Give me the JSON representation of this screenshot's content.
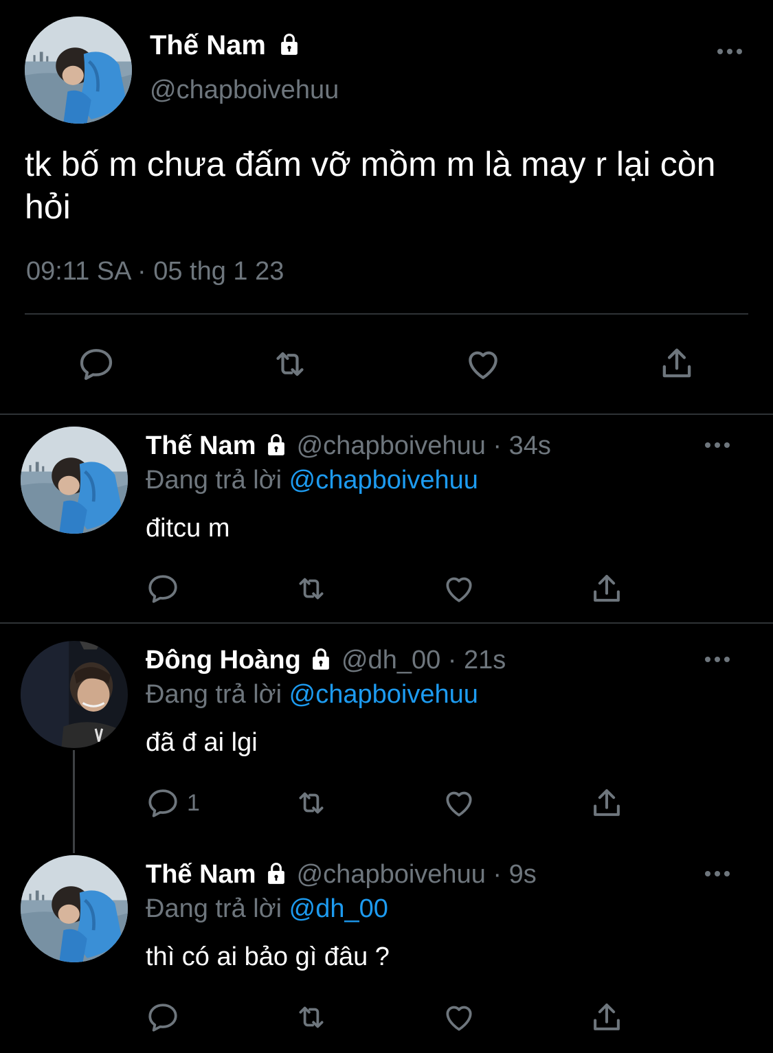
{
  "colors": {
    "background": "#000000",
    "text": "#ffffff",
    "muted": "#6e767d",
    "link": "#1d9bf0",
    "divider": "#2f3336"
  },
  "main_tweet": {
    "display_name": "Thế Nam",
    "handle": "@chapboivehuu",
    "locked_icon": "lock-icon",
    "text": "tk bố m chưa đấm vỡ mồm m là may r lại còn hỏi",
    "timestamp": "09:11 SA · 05 thg 1 23",
    "actions": [
      "reply-icon",
      "retweet-icon",
      "like-icon",
      "share-icon"
    ]
  },
  "replies": [
    {
      "display_name": "Thế Nam",
      "handle": "@chapboivehuu",
      "time": "· 34s",
      "replying_label": "Đang trả lời",
      "replying_to": "@chapboivehuu",
      "text": "đitcu m",
      "reply_count": ""
    },
    {
      "display_name": "Đông Hoàng",
      "handle": "@dh_00",
      "time": "· 21s",
      "replying_label": "Đang trả lời",
      "replying_to": "@chapboivehuu",
      "text": "đã đ ai lgi",
      "reply_count": "1"
    },
    {
      "display_name": "Thế Nam",
      "handle": "@chapboivehuu",
      "time": "· 9s",
      "replying_label": "Đang trả lời",
      "replying_to": "@dh_00",
      "text": "thì có ai bảo gì đâu ?",
      "reply_count": ""
    }
  ]
}
